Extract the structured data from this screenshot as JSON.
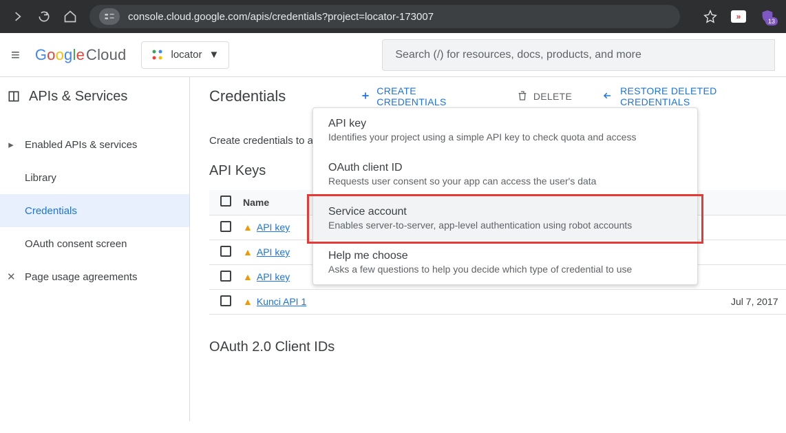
{
  "browser": {
    "url": "console.cloud.google.com/apis/credentials?project=locator-173007",
    "ext_badge_count": "13"
  },
  "header": {
    "logo_product": "Google",
    "logo_suffix": " Cloud",
    "project_name": "locator",
    "search_placeholder": "Search (/) for resources, docs, products, and more"
  },
  "sidebar": {
    "section_title": "APIs & Services",
    "items": [
      {
        "label": "Enabled APIs & services"
      },
      {
        "label": "Library"
      },
      {
        "label": "Credentials"
      },
      {
        "label": "OAuth consent screen"
      },
      {
        "label": "Page usage agreements"
      }
    ],
    "selected_index": 2
  },
  "main": {
    "title": "Credentials",
    "create_btn": "CREATE CREDENTIALS",
    "delete_btn": "DELETE",
    "restore_btn": "RESTORE DELETED CREDENTIALS",
    "subtext_truncated": "Create credentials to ac",
    "api_keys_heading": "API Keys",
    "oauth_heading": "OAuth 2.0 Client IDs",
    "table": {
      "col_name": "Name",
      "rows": [
        {
          "name": "API key",
          "date": ""
        },
        {
          "name": "API key",
          "date": ""
        },
        {
          "name": "API key",
          "date": ""
        },
        {
          "name": "Kunci API 1",
          "date": "Jul 7, 2017"
        }
      ]
    }
  },
  "dropdown": {
    "items": [
      {
        "title": "API key",
        "desc": "Identifies your project using a simple API key to check quota and access"
      },
      {
        "title": "OAuth client ID",
        "desc": "Requests user consent so your app can access the user's data"
      },
      {
        "title": "Service account",
        "desc": "Enables server-to-server, app-level authentication using robot accounts"
      },
      {
        "title": "Help me choose",
        "desc": "Asks a few questions to help you decide which type of credential to use"
      }
    ],
    "hover_index": 2
  }
}
